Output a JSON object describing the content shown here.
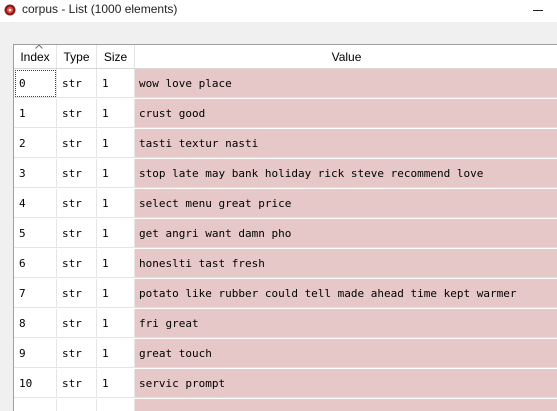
{
  "window": {
    "title": "corpus - List (1000 elements)",
    "minimize_label": "–"
  },
  "colors": {
    "value_bg": "#e6c8c9",
    "app_icon": "#c0392b"
  },
  "table": {
    "columns": [
      "Index",
      "Type",
      "Size",
      "Value"
    ],
    "sort_column": "Index",
    "rows": [
      {
        "index": "0",
        "type": "str",
        "size": "1",
        "value": "wow love place"
      },
      {
        "index": "1",
        "type": "str",
        "size": "1",
        "value": "crust good"
      },
      {
        "index": "2",
        "type": "str",
        "size": "1",
        "value": "tasti textur nasti"
      },
      {
        "index": "3",
        "type": "str",
        "size": "1",
        "value": "stop late may bank holiday rick steve recommend love"
      },
      {
        "index": "4",
        "type": "str",
        "size": "1",
        "value": "select menu great price"
      },
      {
        "index": "5",
        "type": "str",
        "size": "1",
        "value": "get angri want damn pho"
      },
      {
        "index": "6",
        "type": "str",
        "size": "1",
        "value": "honeslti tast fresh"
      },
      {
        "index": "7",
        "type": "str",
        "size": "1",
        "value": "potato like rubber could tell made ahead time kept warmer"
      },
      {
        "index": "8",
        "type": "str",
        "size": "1",
        "value": "fri great"
      },
      {
        "index": "9",
        "type": "str",
        "size": "1",
        "value": "great touch"
      },
      {
        "index": "10",
        "type": "str",
        "size": "1",
        "value": "servic prompt"
      }
    ]
  }
}
